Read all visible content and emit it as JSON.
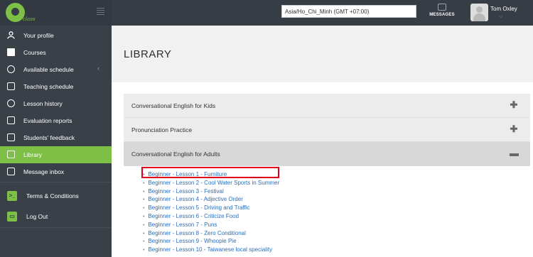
{
  "header": {
    "logo_text": "class",
    "timezone_value": "Asia/Ho_Chi_Minh (GMT +07:00)",
    "messages_label": "MESSAGES",
    "user_name": "Tom Oxley"
  },
  "sidebar": {
    "items": [
      {
        "label": "Your profile",
        "icon": "user-icon"
      },
      {
        "label": "Courses",
        "icon": "book-icon"
      },
      {
        "label": "Available schedule",
        "icon": "clock-icon"
      },
      {
        "label": "Teaching schedule",
        "icon": "calendar-icon"
      },
      {
        "label": "Lesson history",
        "icon": "history-icon"
      },
      {
        "label": "Evaluation reports",
        "icon": "report-icon"
      },
      {
        "label": "Students' feedback",
        "icon": "feedback-icon"
      },
      {
        "label": "Library",
        "icon": "library-icon"
      },
      {
        "label": "Message inbox",
        "icon": "inbox-icon"
      }
    ],
    "active_item": "Library",
    "footer_items": [
      {
        "label": "Terms & Conditions",
        "icon": "terminal-icon"
      },
      {
        "label": "Log Out",
        "icon": "folder-icon"
      }
    ]
  },
  "main": {
    "title": "LIBRARY",
    "accordion": [
      {
        "title": "Conversational English for Kids",
        "state": "collapsed"
      },
      {
        "title": "Pronunciation Practice",
        "state": "collapsed"
      },
      {
        "title": "Conversational English for Adults",
        "state": "expanded"
      }
    ],
    "lessons": [
      "Beginner - Lesson 1 - Furniture",
      "Beginner - Lesson 2 - Cool Water Sports in Summer",
      "Beginner - Lesson 3 - Festival",
      "Beginner - Lesson 4 - Adjective Order",
      "Beginner - Lesson 5 - Driving and Traffic",
      "Beginner - Lesson 6 - Criticize Food",
      "Beginner - Lesson 7 - Puns",
      "Beginner - Lesson 8 - Zero Conditional",
      "Beginner - Lesson 9 - Whoopie Pie",
      "Beginner - Lesson 10 - Taiwanese local speciality"
    ]
  },
  "colors": {
    "accent_green": "#7dc045",
    "sidebar_bg": "#3a4047",
    "link_blue": "#2a6ebb",
    "highlight_red": "#e0001b"
  }
}
